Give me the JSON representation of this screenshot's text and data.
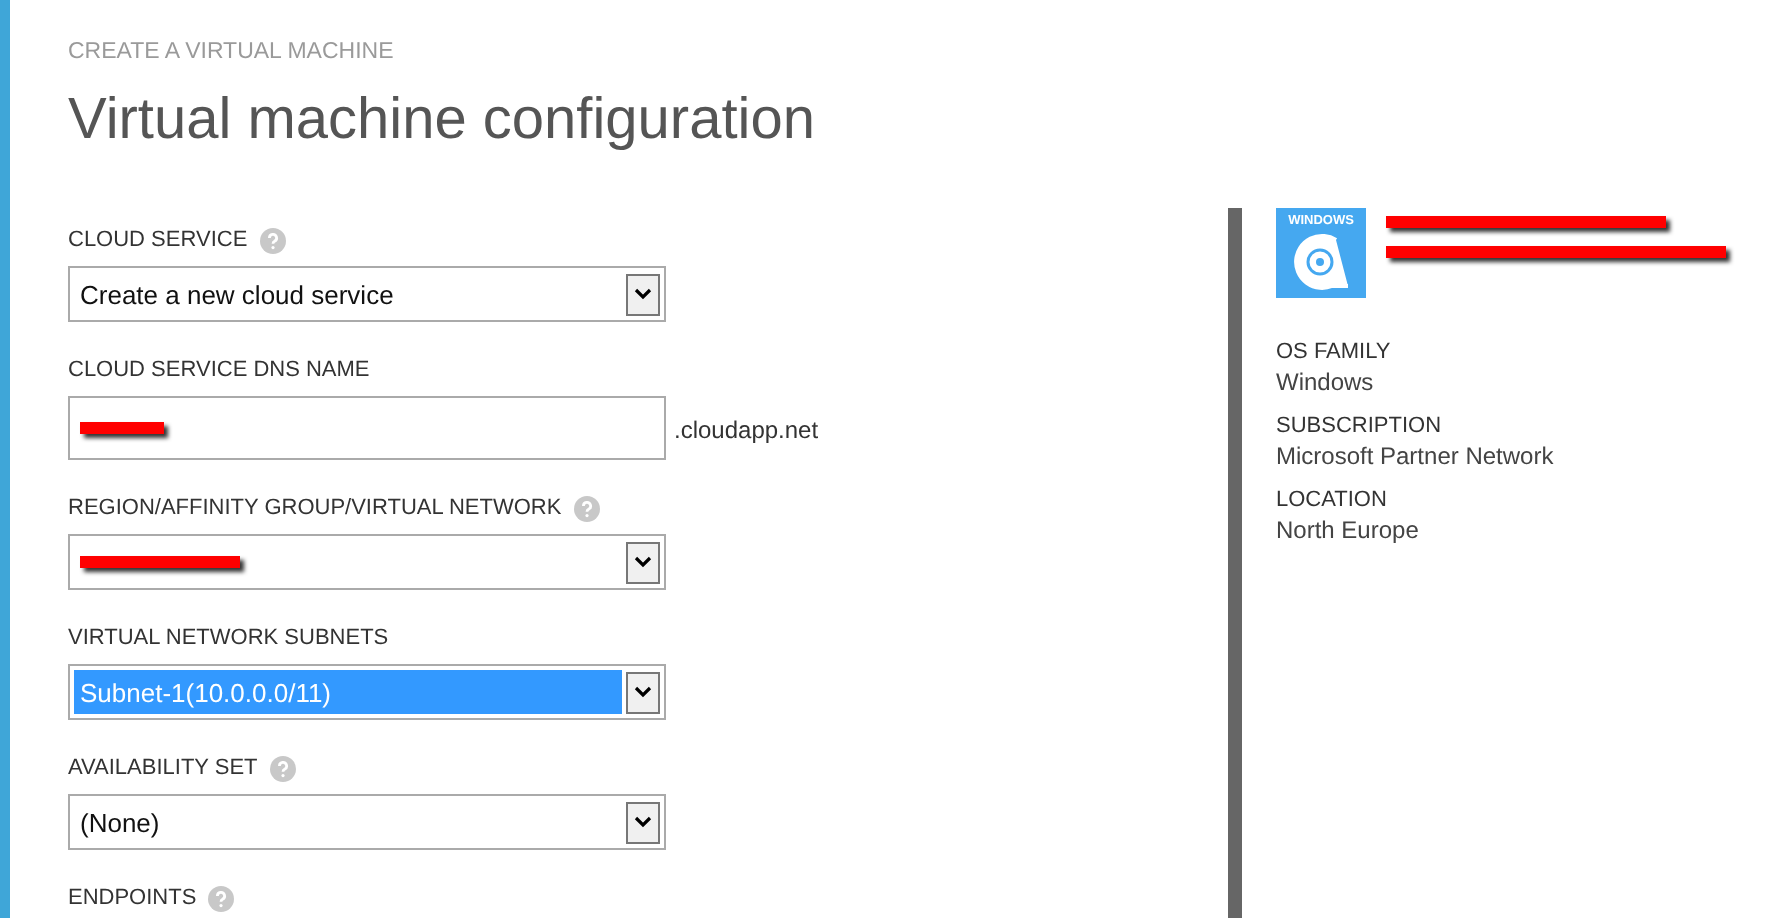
{
  "header": {
    "eyebrow": "CREATE A VIRTUAL MACHINE",
    "title": "Virtual machine configuration"
  },
  "fields": [
    {
      "kind": "select",
      "label": "CLOUD SERVICE",
      "help": true,
      "value": "Create a new cloud service",
      "redacted": false,
      "focused": false
    },
    {
      "kind": "text",
      "label": "CLOUD SERVICE DNS NAME",
      "help": false,
      "redacted": true,
      "suffix": ".cloudapp.net"
    },
    {
      "kind": "select",
      "label": "REGION/AFFINITY GROUP/VIRTUAL NETWORK",
      "help": true,
      "redacted": true,
      "focused": false
    },
    {
      "kind": "select",
      "label": "VIRTUAL NETWORK SUBNETS",
      "help": false,
      "value": "Subnet-1(10.0.0.0/11)",
      "redacted": false,
      "focused": true
    },
    {
      "kind": "select",
      "label": "AVAILABILITY SET",
      "help": true,
      "value": "(None)",
      "redacted": false,
      "focused": false
    },
    {
      "kind": "heading",
      "label": "ENDPOINTS",
      "help": true
    }
  ],
  "summary": {
    "tile_label": "WINDOWS",
    "name_redacted": true,
    "details": [
      {
        "label": "OS FAMILY",
        "value": "Windows"
      },
      {
        "label": "SUBSCRIPTION",
        "value": "Microsoft Partner Network"
      },
      {
        "label": "LOCATION",
        "value": "North Europe"
      }
    ]
  }
}
